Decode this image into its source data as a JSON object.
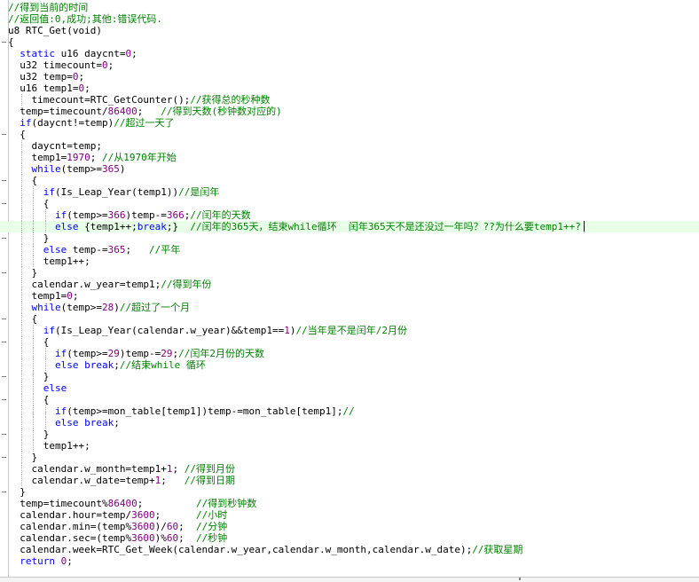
{
  "colors": {
    "comment": "#008000",
    "number": "#800080",
    "keyword": "#0000ff",
    "string": "#800000",
    "highlight": "#e8ffe8"
  },
  "code_lines": [
    {
      "indent": 0,
      "segments": [
        [
          "c",
          "//得到当前的时间"
        ]
      ]
    },
    {
      "indent": 0,
      "segments": [
        [
          "c",
          "//返回值:0,成功;其他:错误代码."
        ]
      ]
    },
    {
      "indent": 0,
      "segments": [
        [
          "t",
          "u8 RTC_Get(void)"
        ]
      ]
    },
    {
      "indent": 0,
      "segments": [
        [
          "t",
          "{"
        ]
      ]
    },
    {
      "indent": 2,
      "segments": [
        [
          "k",
          "static"
        ],
        [
          "t",
          " u16 daycnt="
        ],
        [
          "n",
          "0"
        ],
        [
          "t",
          ";"
        ]
      ]
    },
    {
      "indent": 2,
      "segments": [
        [
          "t",
          "u32 timecount="
        ],
        [
          "n",
          "0"
        ],
        [
          "t",
          ";"
        ]
      ]
    },
    {
      "indent": 2,
      "segments": [
        [
          "t",
          "u32 temp="
        ],
        [
          "n",
          "0"
        ],
        [
          "t",
          ";"
        ]
      ]
    },
    {
      "indent": 2,
      "segments": [
        [
          "t",
          "u16 temp1="
        ],
        [
          "n",
          "0"
        ],
        [
          "t",
          ";"
        ]
      ]
    },
    {
      "indent": 4,
      "segments": [
        [
          "t",
          "timecount=RTC_GetCounter();"
        ],
        [
          "c",
          "//获得总的秒种数"
        ]
      ]
    },
    {
      "indent": 2,
      "segments": [
        [
          "t",
          "temp=timecount/"
        ],
        [
          "n",
          "86400"
        ],
        [
          "t",
          ";   "
        ],
        [
          "c",
          "//得到天数(秒钟数对应的)"
        ]
      ]
    },
    {
      "indent": 2,
      "segments": [
        [
          "k",
          "if"
        ],
        [
          "t",
          "(daycnt!=temp)"
        ],
        [
          "c",
          "//超过一天了"
        ]
      ]
    },
    {
      "indent": 2,
      "segments": [
        [
          "t",
          "{"
        ]
      ]
    },
    {
      "indent": 4,
      "segments": [
        [
          "t",
          "daycnt=temp;"
        ]
      ]
    },
    {
      "indent": 4,
      "segments": [
        [
          "t",
          "temp1="
        ],
        [
          "n",
          "1970"
        ],
        [
          "t",
          "; "
        ],
        [
          "c",
          "//从1970年开始"
        ]
      ]
    },
    {
      "indent": 4,
      "segments": [
        [
          "k",
          "while"
        ],
        [
          "t",
          "(temp>="
        ],
        [
          "n",
          "365"
        ],
        [
          "t",
          ")"
        ]
      ]
    },
    {
      "indent": 4,
      "segments": [
        [
          "t",
          "{"
        ]
      ]
    },
    {
      "indent": 6,
      "segments": [
        [
          "k",
          "if"
        ],
        [
          "t",
          "(Is_Leap_Year(temp1))"
        ],
        [
          "c",
          "//是闰年"
        ]
      ]
    },
    {
      "indent": 6,
      "segments": [
        [
          "t",
          "{"
        ]
      ]
    },
    {
      "indent": 8,
      "segments": [
        [
          "k",
          "if"
        ],
        [
          "t",
          "(temp>="
        ],
        [
          "n",
          "366"
        ],
        [
          "t",
          ")temp-="
        ],
        [
          "n",
          "366"
        ],
        [
          "t",
          ";"
        ],
        [
          "c",
          "//闰年的天数"
        ]
      ]
    },
    {
      "indent": 8,
      "hl": true,
      "caret": true,
      "segments": [
        [
          "k",
          "else"
        ],
        [
          "t",
          " {temp1++;"
        ],
        [
          "k",
          "break"
        ],
        [
          "t",
          ";}  "
        ],
        [
          "c",
          "//闰年的365天，结束while循环  闰年365天不是还没过一年吗？??为什么要temp1++?"
        ]
      ]
    },
    {
      "indent": 6,
      "segments": [
        [
          "t",
          "}"
        ]
      ]
    },
    {
      "indent": 6,
      "segments": [
        [
          "k",
          "else"
        ],
        [
          "t",
          " temp-="
        ],
        [
          "n",
          "365"
        ],
        [
          "t",
          ";   "
        ],
        [
          "c",
          "//平年"
        ]
      ]
    },
    {
      "indent": 6,
      "segments": [
        [
          "t",
          "temp1++;"
        ]
      ]
    },
    {
      "indent": 4,
      "segments": [
        [
          "t",
          "}"
        ]
      ]
    },
    {
      "indent": 4,
      "segments": [
        [
          "t",
          "calendar.w_year=temp1;"
        ],
        [
          "c",
          "//得到年份"
        ]
      ]
    },
    {
      "indent": 4,
      "segments": [
        [
          "t",
          "temp1="
        ],
        [
          "n",
          "0"
        ],
        [
          "t",
          ";"
        ]
      ]
    },
    {
      "indent": 4,
      "segments": [
        [
          "k",
          "while"
        ],
        [
          "t",
          "(temp>="
        ],
        [
          "n",
          "28"
        ],
        [
          "t",
          ")"
        ],
        [
          "c",
          "//超过了一个月"
        ]
      ]
    },
    {
      "indent": 4,
      "segments": [
        [
          "t",
          "{"
        ]
      ]
    },
    {
      "indent": 6,
      "segments": [
        [
          "k",
          "if"
        ],
        [
          "t",
          "(Is_Leap_Year(calendar.w_year)&&temp1=="
        ],
        [
          "n",
          "1"
        ],
        [
          "t",
          ")"
        ],
        [
          "c",
          "//当年是不是闰年/2月份"
        ]
      ]
    },
    {
      "indent": 6,
      "segments": [
        [
          "t",
          "{"
        ]
      ]
    },
    {
      "indent": 8,
      "segments": [
        [
          "k",
          "if"
        ],
        [
          "t",
          "(temp>="
        ],
        [
          "n",
          "29"
        ],
        [
          "t",
          ")temp-="
        ],
        [
          "n",
          "29"
        ],
        [
          "t",
          ";"
        ],
        [
          "c",
          "//闰年2月份的天数"
        ]
      ]
    },
    {
      "indent": 8,
      "segments": [
        [
          "k",
          "else"
        ],
        [
          "t",
          " "
        ],
        [
          "k",
          "break"
        ],
        [
          "t",
          ";"
        ],
        [
          "c",
          "//结束while 循环"
        ]
      ]
    },
    {
      "indent": 6,
      "segments": [
        [
          "t",
          "}"
        ]
      ]
    },
    {
      "indent": 6,
      "segments": [
        [
          "k",
          "else"
        ]
      ]
    },
    {
      "indent": 6,
      "segments": [
        [
          "t",
          "{"
        ]
      ]
    },
    {
      "indent": 8,
      "segments": [
        [
          "k",
          "if"
        ],
        [
          "t",
          "(temp>=mon_table[temp1])temp-=mon_table[temp1];"
        ],
        [
          "c",
          "//"
        ]
      ]
    },
    {
      "indent": 8,
      "segments": [
        [
          "k",
          "else"
        ],
        [
          "t",
          " "
        ],
        [
          "k",
          "break"
        ],
        [
          "t",
          ";"
        ]
      ]
    },
    {
      "indent": 6,
      "segments": [
        [
          "t",
          "}"
        ]
      ]
    },
    {
      "indent": 6,
      "segments": [
        [
          "t",
          "temp1++;"
        ]
      ]
    },
    {
      "indent": 4,
      "segments": [
        [
          "t",
          "}"
        ]
      ]
    },
    {
      "indent": 4,
      "segments": [
        [
          "t",
          "calendar.w_month=temp1+"
        ],
        [
          "n",
          "1"
        ],
        [
          "t",
          "; "
        ],
        [
          "c",
          "//得到月份"
        ]
      ]
    },
    {
      "indent": 4,
      "segments": [
        [
          "t",
          "calendar.w_date=temp+"
        ],
        [
          "n",
          "1"
        ],
        [
          "t",
          ";   "
        ],
        [
          "c",
          "//得到日期"
        ]
      ]
    },
    {
      "indent": 2,
      "segments": [
        [
          "t",
          "}"
        ]
      ]
    },
    {
      "indent": 2,
      "segments": [
        [
          "t",
          "temp=timecount%"
        ],
        [
          "n",
          "86400"
        ],
        [
          "t",
          ";         "
        ],
        [
          "c",
          "//得到秒钟数"
        ]
      ]
    },
    {
      "indent": 2,
      "segments": [
        [
          "t",
          "calendar.hour=temp/"
        ],
        [
          "n",
          "3600"
        ],
        [
          "t",
          ";      "
        ],
        [
          "c",
          "//小时"
        ]
      ]
    },
    {
      "indent": 2,
      "segments": [
        [
          "t",
          "calendar.min=(temp%"
        ],
        [
          "n",
          "3600"
        ],
        [
          "t",
          ")/"
        ],
        [
          "n",
          "60"
        ],
        [
          "t",
          ";  "
        ],
        [
          "c",
          "//分钟"
        ]
      ]
    },
    {
      "indent": 2,
      "segments": [
        [
          "t",
          "calendar.sec=(temp%"
        ],
        [
          "n",
          "3600"
        ],
        [
          "t",
          ")%"
        ],
        [
          "n",
          "60"
        ],
        [
          "t",
          ";  "
        ],
        [
          "c",
          "//秒钟"
        ]
      ]
    },
    {
      "indent": 2,
      "segments": [
        [
          "t",
          "calendar.week=RTC_Get_Week(calendar.w_year,calendar.w_month,calendar.w_date);"
        ],
        [
          "c",
          "//获取星期"
        ]
      ]
    },
    {
      "indent": 2,
      "segments": [
        [
          "k",
          "return"
        ],
        [
          "t",
          " "
        ],
        [
          "n",
          "0"
        ],
        [
          "t",
          ";"
        ]
      ]
    }
  ]
}
